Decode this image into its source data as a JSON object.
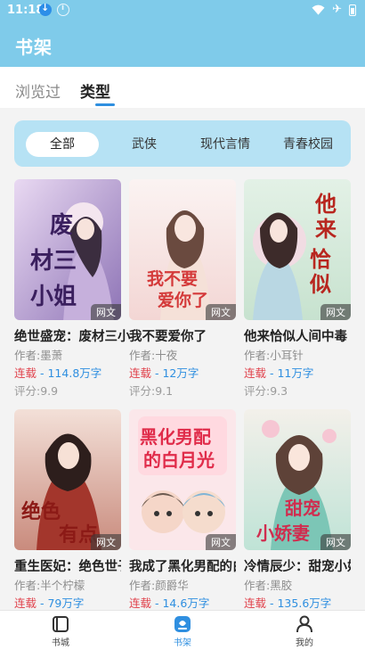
{
  "status_bar": {
    "time": "11:18"
  },
  "header": {
    "title": "书架"
  },
  "top_tabs": [
    {
      "label": "浏览过",
      "active": false
    },
    {
      "label": "类型",
      "active": true
    }
  ],
  "filters": {
    "selected": "全部",
    "items": [
      "全部",
      "武侠",
      "现代言情",
      "青春校园"
    ]
  },
  "accent_color": "#2f8fe0",
  "header_color": "#7fcbea",
  "books": [
    {
      "title": "绝世盛宠：废材三小姐",
      "author": "作者:墨萧",
      "state": "连载",
      "words": "114.8万字",
      "score": "评分:9.9",
      "badge": "网文",
      "cover_text": "废材三小姐",
      "cover_theme": "purple"
    },
    {
      "title": "我不要爱你了",
      "author": "作者:十夜",
      "state": "连载",
      "words": "12万字",
      "score": "评分:9.1",
      "badge": "网文",
      "cover_text": "我不要爱你了",
      "cover_theme": "pink"
    },
    {
      "title": "他来恰似人间中毒",
      "author": "作者:小耳针",
      "state": "连载",
      "words": "11万字",
      "score": "评分:9.3",
      "badge": "网文",
      "cover_text": "他来恰似人",
      "cover_theme": "green"
    },
    {
      "title": "重生医妃：绝色世子妃有点狂",
      "author": "作者:半个柠檬",
      "state": "连载",
      "words": "79万字",
      "score": "",
      "badge": "网文",
      "cover_text": "绝色世子妃有点狂",
      "cover_theme": "red"
    },
    {
      "title": "我成了黑化男配的白月光",
      "author": "作者:颜爵华",
      "state": "连载",
      "words": "14.6万字",
      "score": "",
      "badge": "网文",
      "cover_text": "黑化男配的白月光",
      "cover_theme": "cartoon"
    },
    {
      "title": "冷情辰少：甜宠小娇妻",
      "author": "作者:黑胶",
      "state": "连载",
      "words": "135.6万字",
      "score": "",
      "badge": "网文",
      "cover_text": "甜宠小娇妻",
      "cover_theme": "mint"
    }
  ],
  "bottom_nav": [
    {
      "label": "书城",
      "icon": "book-city-icon",
      "active": false
    },
    {
      "label": "书架",
      "icon": "bookshelf-icon",
      "active": true
    },
    {
      "label": "我的",
      "icon": "profile-icon",
      "active": false
    }
  ]
}
